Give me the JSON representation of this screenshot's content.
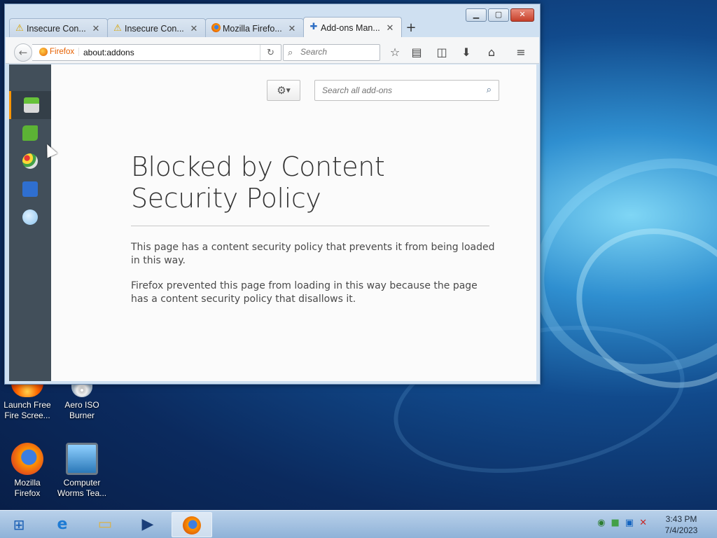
{
  "browser": {
    "tabs": [
      {
        "label": "Insecure Con...",
        "icon": "warning-icon",
        "active": false
      },
      {
        "label": "Insecure Con...",
        "icon": "warning-icon",
        "active": false
      },
      {
        "label": "Mozilla Firefo...",
        "icon": "firefox-icon",
        "active": false
      },
      {
        "label": "Add-ons Man...",
        "icon": "puzzle-icon",
        "active": true
      }
    ],
    "new_tab_glyph": "+",
    "identity_label": "Firefox",
    "url": "about:addons",
    "search_placeholder": "Search"
  },
  "addons": {
    "search_placeholder": "Search all add-ons",
    "categories": [
      {
        "name": "get-addons",
        "selected": true
      },
      {
        "name": "extensions",
        "selected": false
      },
      {
        "name": "appearance",
        "selected": false
      },
      {
        "name": "plugins",
        "selected": false
      },
      {
        "name": "services",
        "selected": false
      }
    ]
  },
  "error": {
    "title": "Blocked by Content Security Policy",
    "paragraph1": "This page has a content security policy that prevents it from being loaded in this way.",
    "paragraph2": "Firefox prevented this page from loading in this way because the page has a content security policy that disallows it."
  },
  "desktop": {
    "icons": [
      {
        "label_line1": "Launch Free",
        "label_line2": "Fire Scree..."
      },
      {
        "label_line1": "Aero ISO",
        "label_line2": "Burner"
      },
      {
        "label_line1": "Mozilla",
        "label_line2": "Firefox"
      },
      {
        "label_line1": "Computer",
        "label_line2": "Worms Tea..."
      }
    ]
  },
  "taskbar": {
    "time": "3:43 PM",
    "date": "7/4/2023"
  },
  "colors": {
    "sidebar": "#424f5a",
    "accent": "#ff9500",
    "firefox_orange": "#e66000"
  }
}
